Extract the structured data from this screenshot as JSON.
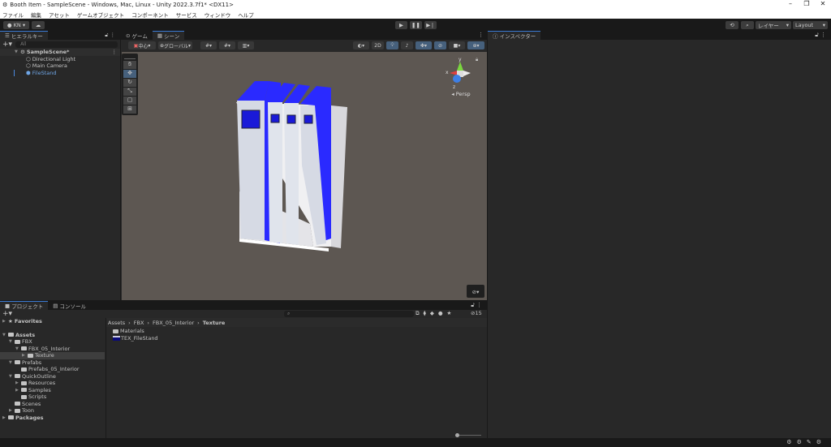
{
  "window": {
    "title": "Booth Item - SampleScene - Windows, Mac, Linux - Unity 2022.3.7f1* <DX11>",
    "controls": [
      "–",
      "❐",
      "✕"
    ]
  },
  "menu": [
    "ファイル",
    "編集",
    "アセット",
    "ゲームオブジェクト",
    "コンポーネント",
    "サービス",
    "ウィンドウ",
    "ヘルプ"
  ],
  "toolbar": {
    "account": "KN ▾",
    "layers": "レイヤー",
    "layout": "Layout"
  },
  "hierarchy": {
    "tab": "ヒエラルキー",
    "search_placeholder": "All",
    "scene": "SampleScene*",
    "items": [
      "Directional Light",
      "Main Camera",
      "FileStand"
    ]
  },
  "scene_view": {
    "tabs": [
      "ゲーム",
      "シーン"
    ],
    "pivot": "中心",
    "space": "グローバル",
    "mode_2d": "2D",
    "persp": "Persp",
    "axes": {
      "x": "x",
      "y": "y",
      "z": "z"
    }
  },
  "inspector": {
    "tab": "インスペクター"
  },
  "project": {
    "tabs": [
      "プロジェクト",
      "コンソール"
    ],
    "favorites": "Favorites",
    "tree": [
      {
        "label": "Assets",
        "depth": 0,
        "bold": true,
        "open": true
      },
      {
        "label": "FBX",
        "depth": 1,
        "open": true
      },
      {
        "label": "FBX_05_Interior",
        "depth": 2,
        "open": true
      },
      {
        "label": "Texture",
        "depth": 3,
        "selected": true
      },
      {
        "label": "Prefabs",
        "depth": 1,
        "open": true
      },
      {
        "label": "Prefabs_05_Interior",
        "depth": 2
      },
      {
        "label": "QuickOutline",
        "depth": 1,
        "open": true
      },
      {
        "label": "Resources",
        "depth": 2
      },
      {
        "label": "Samples",
        "depth": 2
      },
      {
        "label": "Scripts",
        "depth": 2
      },
      {
        "label": "Scenes",
        "depth": 1
      },
      {
        "label": "Toon",
        "depth": 1
      },
      {
        "label": "Packages",
        "depth": 0,
        "bold": true
      }
    ],
    "breadcrumb": [
      "Assets",
      "FBX",
      "FBX_05_Interior",
      "Texture"
    ],
    "files": [
      "Materials",
      "TEX_FileStand"
    ],
    "hidden_count": "15"
  }
}
